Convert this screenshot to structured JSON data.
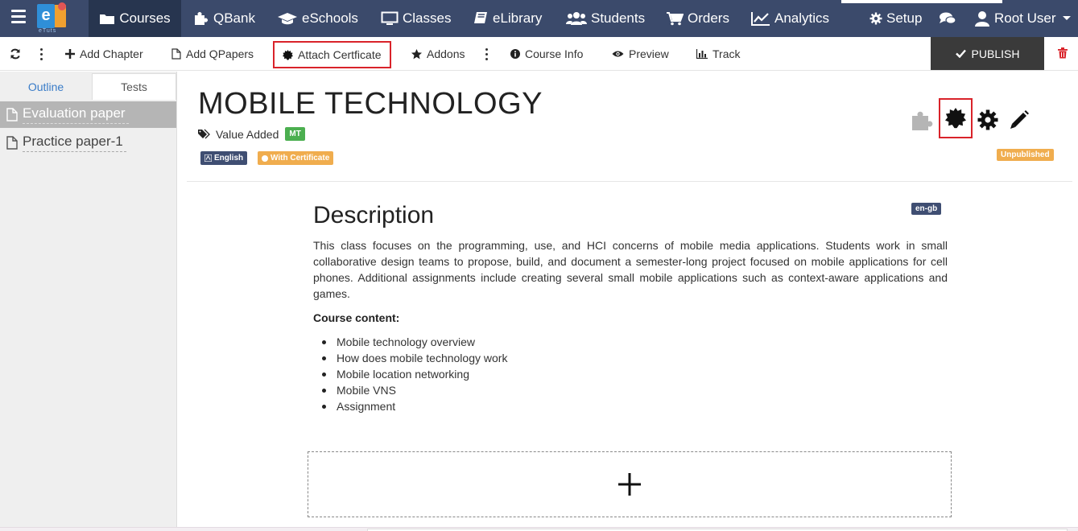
{
  "colors": {
    "nav_bg": "#3b4a6b",
    "nav_active": "#27354f",
    "highlight": "#d9232a",
    "publish_bg": "#3a3a3a",
    "badge_green": "#4caf50",
    "badge_orange": "#f0ad4e",
    "badge_navy": "#3f4e72",
    "link_blue": "#3a7cc8"
  },
  "nav": {
    "logo_text": "eTuts",
    "items": [
      {
        "label": "Courses",
        "icon": "folder-icon"
      },
      {
        "label": "QBank",
        "icon": "puzzle-icon"
      },
      {
        "label": "eSchools",
        "icon": "graduation-cap-icon"
      },
      {
        "label": "Classes",
        "icon": "monitor-icon"
      },
      {
        "label": "eLibrary",
        "icon": "book-icon"
      },
      {
        "label": "Students",
        "icon": "users-icon"
      },
      {
        "label": "Orders",
        "icon": "cart-icon"
      },
      {
        "label": "Analytics",
        "icon": "line-chart-icon"
      }
    ],
    "setup": "Setup",
    "user": "Root User"
  },
  "toolbar": {
    "add_chapter": "Add Chapter",
    "add_qpapers": "Add QPapers",
    "attach_certificate": "Attach Certficate",
    "addons": "Addons",
    "course_info": "Course Info",
    "preview": "Preview",
    "track": "Track",
    "publish": "PUBLISH"
  },
  "sidebar": {
    "tabs": [
      "Outline",
      "Tests"
    ],
    "items": [
      {
        "label": "Evaluation paper",
        "active": true
      },
      {
        "label": "Practice paper-1",
        "active": false
      }
    ]
  },
  "course": {
    "title": "MOBILE TECHNOLOGY",
    "category": "Value Added",
    "code_badge": "MT",
    "language_badge": "English",
    "certificate_badge": "With Certificate",
    "status_badge": "Unpublished"
  },
  "description": {
    "heading": "Description",
    "lang_badge": "en-gb",
    "paragraph": "This class focuses on the programming, use, and HCI concerns of mobile media applications. Students work in small collaborative design teams to propose, build, and document a semester-long project focused on mobile applications for cell phones. Additional assignments include creating several small mobile applications such as context-aware applications and games.",
    "content_heading": "Course content:",
    "content_items": [
      "Mobile technology overview",
      "How does mobile technology work",
      "Mobile location networking",
      "Mobile VNS",
      "Assignment"
    ]
  },
  "add_block": {
    "symbol": "+"
  }
}
